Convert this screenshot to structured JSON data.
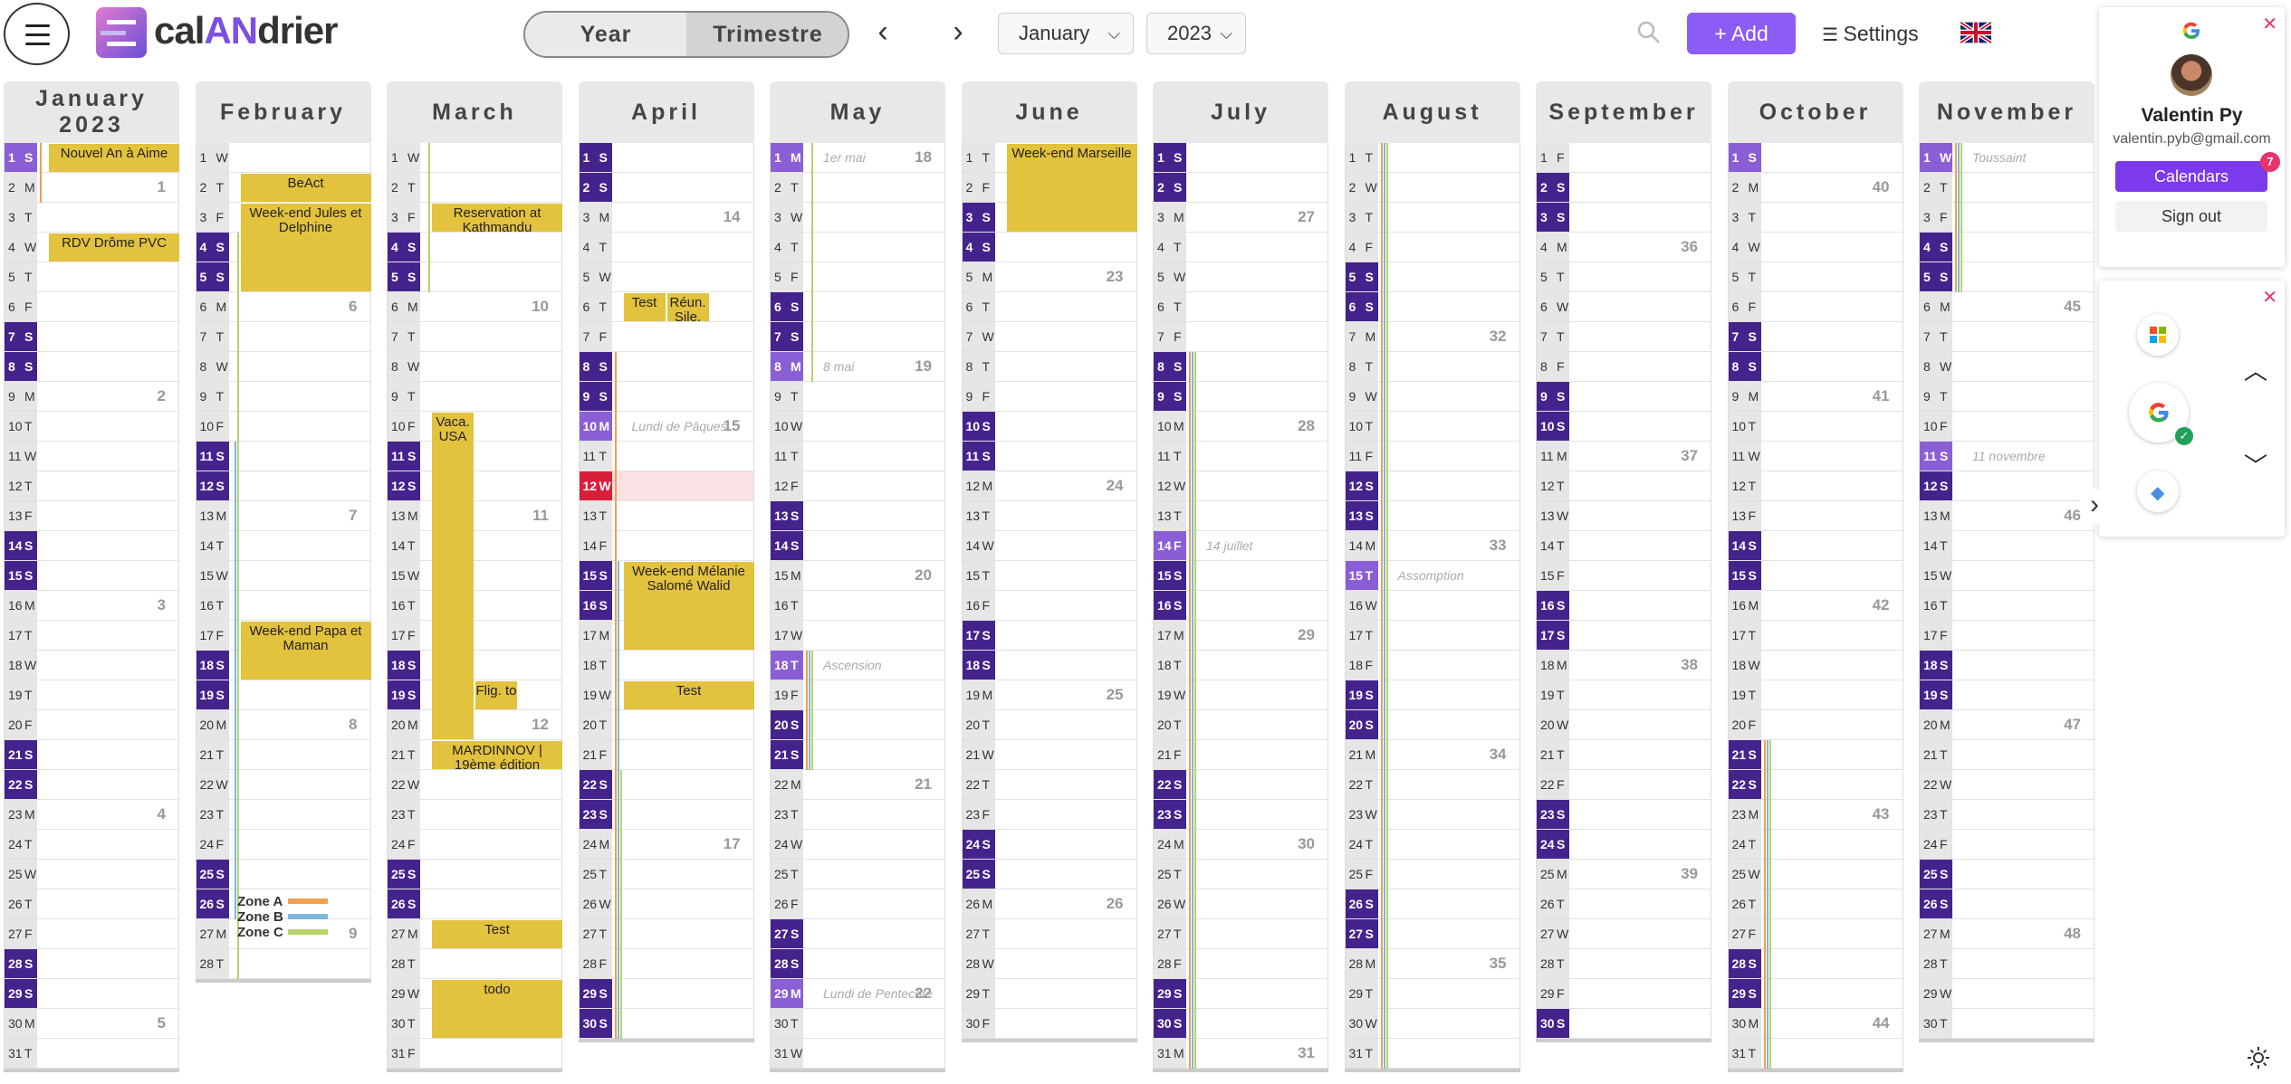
{
  "header": {
    "logo_prefix": "cal",
    "logo_mid": "AN",
    "logo_suffix": "drier",
    "view_year": "Year",
    "view_trimestre": "Trimestre",
    "month_select": "January",
    "year_select": "2023",
    "add_label": "Add",
    "settings_label": "Settings"
  },
  "account": {
    "name": "Valentin Py",
    "email": "valentin.pyb@gmail.com",
    "calendars_label": "Calendars",
    "calendars_badge": "7",
    "signout_label": "Sign out"
  },
  "legend": [
    {
      "label": "Zone A",
      "color": "#f0a050"
    },
    {
      "label": "Zone B",
      "color": "#7db7dc"
    },
    {
      "label": "Zone C",
      "color": "#b8d36a"
    }
  ],
  "colors": {
    "weekend": "#45238c",
    "holiday": "#8a5fd6",
    "today": "#d91e3a",
    "event": "#e3c23d",
    "accent": "#8b5cf6"
  },
  "months": [
    {
      "name": "January",
      "year": "2023",
      "days": 31,
      "start": 6,
      "weeks": {
        "2": "1",
        "9": "2",
        "16": "3",
        "23": "4",
        "30": "5"
      },
      "holidays": {
        "1": "Nouvel An"
      }
    },
    {
      "name": "February",
      "year": "",
      "days": 28,
      "start": 2,
      "weeks": {
        "6": "6",
        "13": "7",
        "20": "8",
        "27": "9"
      },
      "holidays": {}
    },
    {
      "name": "March",
      "year": "",
      "days": 31,
      "start": 2,
      "weeks": {
        "6": "10",
        "13": "11",
        "20": "12",
        "27": "13"
      },
      "holidays": {}
    },
    {
      "name": "April",
      "year": "",
      "days": 30,
      "start": 5,
      "weeks": {
        "3": "14",
        "10": "15",
        "17": "16",
        "24": "17"
      },
      "holidays": {
        "10": "Lundi de Pâques"
      },
      "today": 12
    },
    {
      "name": "May",
      "year": "",
      "days": 31,
      "start": 0,
      "weeks": {
        "1": "18",
        "8": "19",
        "15": "20",
        "22": "21",
        "29": "22"
      },
      "holidays": {
        "1": "1er mai",
        "8": "8 mai",
        "18": "Ascension",
        "29": "Lundi de Pentecôte"
      }
    },
    {
      "name": "June",
      "year": "",
      "days": 30,
      "start": 3,
      "weeks": {
        "5": "23",
        "12": "24",
        "19": "25",
        "26": "26"
      },
      "holidays": {}
    },
    {
      "name": "July",
      "year": "",
      "days": 31,
      "start": 5,
      "weeks": {
        "3": "27",
        "10": "28",
        "17": "29",
        "24": "30",
        "31": "31"
      },
      "holidays": {
        "14": "14 juillet"
      }
    },
    {
      "name": "August",
      "year": "",
      "days": 31,
      "start": 1,
      "weeks": {
        "7": "32",
        "14": "33",
        "21": "34",
        "28": "35"
      },
      "holidays": {
        "15": "Assomption"
      }
    },
    {
      "name": "September",
      "year": "",
      "days": 30,
      "start": 4,
      "weeks": {
        "4": "36",
        "11": "37",
        "18": "38",
        "25": "39"
      },
      "holidays": {}
    },
    {
      "name": "October",
      "year": "",
      "days": 31,
      "start": 6,
      "weeks": {
        "2": "40",
        "9": "41",
        "16": "42",
        "23": "43",
        "30": "44"
      },
      "holidays": {
        "1": ""
      }
    },
    {
      "name": "November",
      "year": "",
      "days": 30,
      "start": 2,
      "weeks": {
        "6": "45",
        "13": "46",
        "20": "47",
        "27": "48"
      },
      "holidays": {
        "1": "Toussaint",
        "11": "11 novembre"
      }
    }
  ],
  "day_letters": [
    "M",
    "T",
    "W",
    "T",
    "F",
    "S",
    "S"
  ],
  "events": [
    {
      "month": 0,
      "start": 1,
      "end": 1,
      "label": "Nouvel An à Aime"
    },
    {
      "month": 0,
      "start": 4,
      "end": 4,
      "label": "RDV Drôme PVC"
    },
    {
      "month": 1,
      "start": 2,
      "end": 2,
      "label": "BeAct"
    },
    {
      "month": 1,
      "start": 3,
      "end": 5,
      "label": "Week-end Jules et Delphine"
    },
    {
      "month": 1,
      "start": 17,
      "end": 18,
      "label": "Week-end Papa et Maman"
    },
    {
      "month": 2,
      "start": 3,
      "end": 3,
      "label": "Reservation at Kathmandu"
    },
    {
      "month": 2,
      "start": 10,
      "end": 20,
      "label": "Vaca. USA",
      "narrow": true
    },
    {
      "month": 2,
      "start": 19,
      "end": 19,
      "label": "Flig. to",
      "col": 1
    },
    {
      "month": 2,
      "start": 21,
      "end": 21,
      "label": "MARDINNOV | 19ème édition"
    },
    {
      "month": 2,
      "start": 27,
      "end": 27,
      "label": "Test"
    },
    {
      "month": 2,
      "start": 29,
      "end": 30,
      "label": "todo"
    },
    {
      "month": 3,
      "start": 6,
      "end": 6,
      "label": "Test",
      "col": 0
    },
    {
      "month": 3,
      "start": 6,
      "end": 6,
      "label": "Réun. Sile.",
      "col": 1
    },
    {
      "month": 3,
      "start": 15,
      "end": 17,
      "label": "Week-end Mélanie Salomé Walid"
    },
    {
      "month": 3,
      "start": 19,
      "end": 19,
      "label": "Test"
    },
    {
      "month": 5,
      "start": 1,
      "end": 3,
      "label": "Week-end Marseille"
    }
  ]
}
